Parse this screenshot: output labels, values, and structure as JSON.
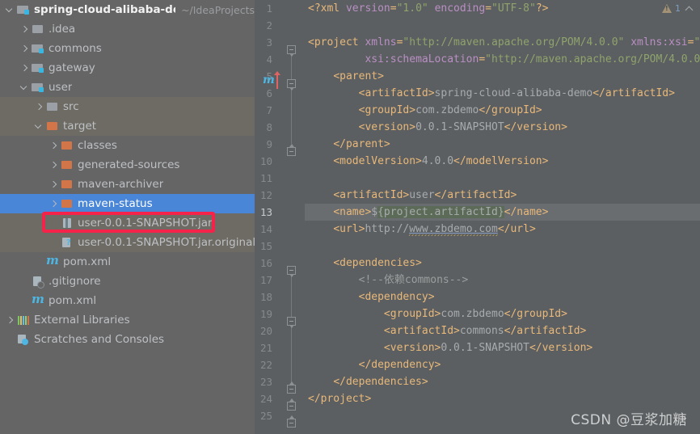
{
  "window": {
    "ide": "IntelliJ IDEA",
    "watermark": "CSDN @豆浆加糖"
  },
  "project_tree": {
    "root_label": "spring-cloud-alibaba-demo",
    "root_path": "~/IdeaProjects",
    "items": [
      {
        "label": ".idea",
        "icon": "folder-icon",
        "indent": 1,
        "arrow": "right",
        "state": "normal"
      },
      {
        "label": "commons",
        "icon": "module-folder-icon",
        "indent": 1,
        "arrow": "right",
        "state": "normal"
      },
      {
        "label": "gateway",
        "icon": "module-folder-icon",
        "indent": 1,
        "arrow": "right",
        "state": "normal"
      },
      {
        "label": "user",
        "icon": "module-folder-icon",
        "indent": 1,
        "arrow": "down",
        "state": "normal"
      },
      {
        "label": "src",
        "icon": "folder-icon",
        "indent": 2,
        "arrow": "right",
        "state": "hovered"
      },
      {
        "label": "target",
        "icon": "excluded-folder-icon",
        "indent": 2,
        "arrow": "down",
        "state": "hovered"
      },
      {
        "label": "classes",
        "icon": "excluded-folder-icon",
        "indent": 3,
        "arrow": "right",
        "state": "normal"
      },
      {
        "label": "generated-sources",
        "icon": "excluded-folder-icon",
        "indent": 3,
        "arrow": "right",
        "state": "normal"
      },
      {
        "label": "maven-archiver",
        "icon": "excluded-folder-icon",
        "indent": 3,
        "arrow": "right",
        "state": "normal"
      },
      {
        "label": "maven-status",
        "icon": "excluded-folder-icon",
        "indent": 3,
        "arrow": "right",
        "state": "selected"
      },
      {
        "label": "user-0.0.1-SNAPSHOT.jar",
        "icon": "jar-icon",
        "indent": 3,
        "arrow": "none",
        "state": "hovered"
      },
      {
        "label": "user-0.0.1-SNAPSHOT.jar.original",
        "icon": "jar-original-icon",
        "indent": 3,
        "arrow": "none",
        "state": "hovered"
      },
      {
        "label": "pom.xml",
        "icon": "maven-icon",
        "indent": 2,
        "arrow": "none",
        "state": "normal"
      },
      {
        "label": ".gitignore",
        "icon": "gitignore-icon",
        "indent": 1,
        "arrow": "none",
        "state": "normal"
      },
      {
        "label": "pom.xml",
        "icon": "maven-icon",
        "indent": 1,
        "arrow": "none",
        "state": "normal"
      },
      {
        "label": "External Libraries",
        "icon": "libraries-icon",
        "indent": 0,
        "arrow": "right",
        "state": "normal"
      },
      {
        "label": "Scratches and Consoles",
        "icon": "scratches-icon",
        "indent": 0,
        "arrow": "none",
        "state": "normal"
      }
    ],
    "annotation": {
      "type": "red-rectangle",
      "target": "user-0.0.1-SNAPSHOT.jar",
      "color": "#f5234a"
    }
  },
  "editor": {
    "file": "pom.xml",
    "current_line": 13,
    "inspection": {
      "warning_count": "1",
      "chevron": "^"
    },
    "line_numbers": [
      "1",
      "2",
      "3",
      "4",
      "5",
      "6",
      "7",
      "8",
      "9",
      "10",
      "11",
      "12",
      "13",
      "14",
      "15",
      "16",
      "17",
      "18",
      "19",
      "20",
      "21",
      "22",
      "23",
      "24",
      "25"
    ],
    "lines": [
      {
        "n": 1,
        "text": "<?xml version=\"1.0\" encoding=\"UTF-8\"?>"
      },
      {
        "n": 2,
        "text": ""
      },
      {
        "n": 3,
        "text": "<project xmlns=\"http://maven.apache.org/POM/4.0.0\" xmlns:xsi=\""
      },
      {
        "n": 4,
        "text": "         xsi:schemaLocation=\"http://maven.apache.org/POM/4.0.0"
      },
      {
        "n": 5,
        "text": "    <parent>"
      },
      {
        "n": 6,
        "text": "        <artifactId>spring-cloud-alibaba-demo</artifactId>"
      },
      {
        "n": 7,
        "text": "        <groupId>com.zbdemo</groupId>"
      },
      {
        "n": 8,
        "text": "        <version>0.0.1-SNAPSHOT</version>"
      },
      {
        "n": 9,
        "text": "    </parent>"
      },
      {
        "n": 10,
        "text": "    <modelVersion>4.0.0</modelVersion>"
      },
      {
        "n": 11,
        "text": ""
      },
      {
        "n": 12,
        "text": "    <artifactId>user</artifactId>"
      },
      {
        "n": 13,
        "text": "    <name>${project.artifactId}</name>"
      },
      {
        "n": 14,
        "text": "    <url>http://www.zbdemo.com</url>"
      },
      {
        "n": 15,
        "text": ""
      },
      {
        "n": 16,
        "text": "    <dependencies>"
      },
      {
        "n": 17,
        "text": "        <!--依赖commons-->"
      },
      {
        "n": 18,
        "text": "        <dependency>"
      },
      {
        "n": 19,
        "text": "            <groupId>com.zbdemo</groupId>"
      },
      {
        "n": 20,
        "text": "            <artifactId>commons</artifactId>"
      },
      {
        "n": 21,
        "text": "            <version>0.0.1-SNAPSHOT</version>"
      },
      {
        "n": 22,
        "text": "        </dependency>"
      },
      {
        "n": 23,
        "text": "    </dependencies>"
      },
      {
        "n": 24,
        "text": "</project>"
      },
      {
        "n": 25,
        "text": ""
      }
    ],
    "gutter_icon": {
      "name": "maven-reimport-icon",
      "glyph": "m",
      "line": 5
    }
  },
  "colors": {
    "sidebar_bg": "#656565",
    "editor_bg": "#5c5f61",
    "selection_blue": "#4a86d8",
    "annotation_red": "#f5234a",
    "tag": "#e8b87a",
    "attr": "#b98fc4",
    "value": "#8fa36c"
  }
}
